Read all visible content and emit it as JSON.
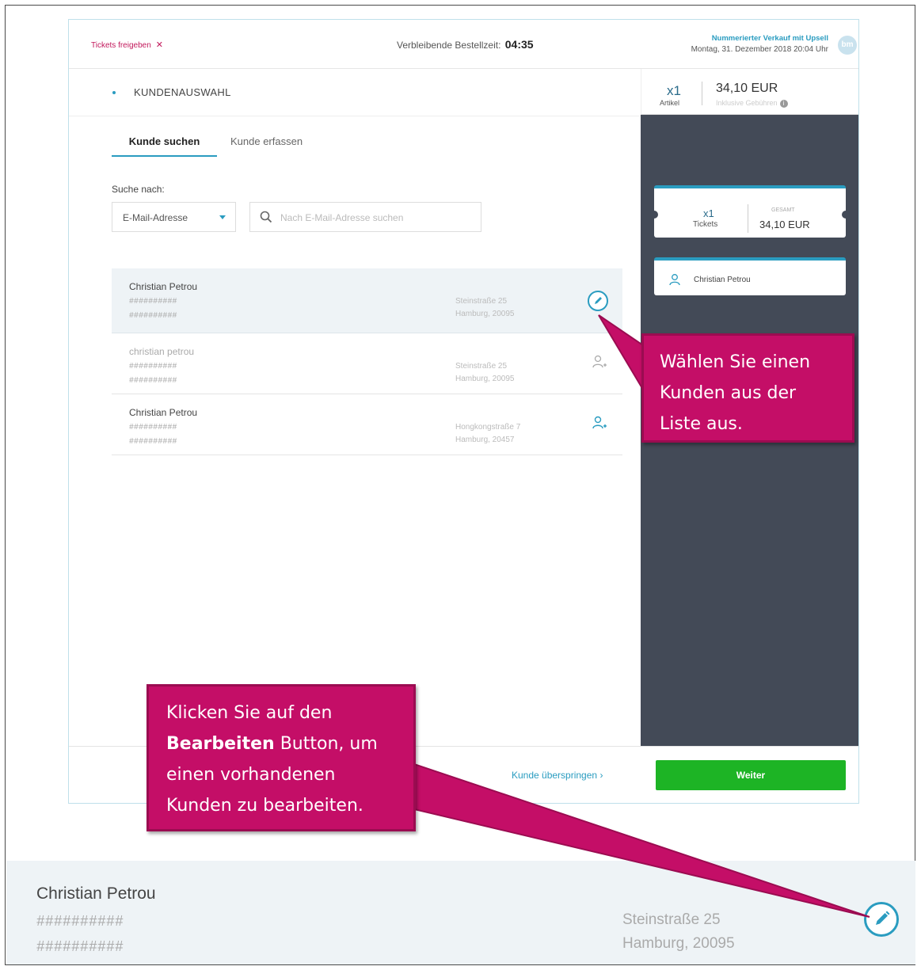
{
  "topbar": {
    "release_label": "Tickets freigeben",
    "release_icon": "close-icon",
    "timer_label": "Verbleibende Bestellzeit:",
    "timer_value": "04:35",
    "event_name": "Nummerierter Verkauf mit Upsell",
    "event_date": "Montag, 31. Dezember 2018 20:04 Uhr",
    "avatar_initials": "bm"
  },
  "section": {
    "title": "KUNDENAUSWAHL"
  },
  "tabs": [
    {
      "label": "Kunde suchen",
      "active": true
    },
    {
      "label": "Kunde erfassen",
      "active": false
    }
  ],
  "search": {
    "label": "Suche nach:",
    "select_value": "E-Mail-Adresse",
    "placeholder": "Nach E-Mail-Adresse suchen"
  },
  "customers": [
    {
      "name": "Christian Petrou",
      "masked1": "##########",
      "masked2": "##########",
      "street": "Steinstraße 25",
      "city": "Hamburg, 20095",
      "action": "edit"
    },
    {
      "name": "christian petrou",
      "masked1": "##########",
      "masked2": "##########",
      "street": "Steinstraße 25",
      "city": "Hamburg, 20095",
      "action": "add-user"
    },
    {
      "name": "Christian Petrou",
      "masked1": "##########",
      "masked2": "##########",
      "street": "Hongkongstraße 7",
      "city": "Hamburg, 20457",
      "action": "add-user"
    }
  ],
  "summary": {
    "count": "x1",
    "count_label": "Artikel",
    "price": "34,10 EUR",
    "price_note": "Inklusive Gebühren",
    "tickets_count": "x1",
    "tickets_label": "Tickets",
    "total_label": "GESAMT",
    "total_value": "34,10 EUR",
    "customer_name": "Christian Petrou"
  },
  "footer": {
    "skip_label": "Kunde überspringen",
    "next_label": "Weiter"
  },
  "callouts": {
    "select_text": "Wählen Sie einen Kunden aus der Liste aus.",
    "edit_pre": "Klicken Sie auf den",
    "edit_bold": "Bearbeiten",
    "edit_post": "Button, um einen vorhandenen Kunden zu bearbeiten."
  },
  "zoom": {
    "name": "Christian Petrou",
    "masked1": "##########",
    "masked2": "##########",
    "street": "Steinstraße 25",
    "city": "Hamburg, 20095"
  },
  "colors": {
    "accent": "#2a9cc0",
    "callout": "#c40e67",
    "sidebar": "#434a57",
    "next_button": "#1db425"
  }
}
